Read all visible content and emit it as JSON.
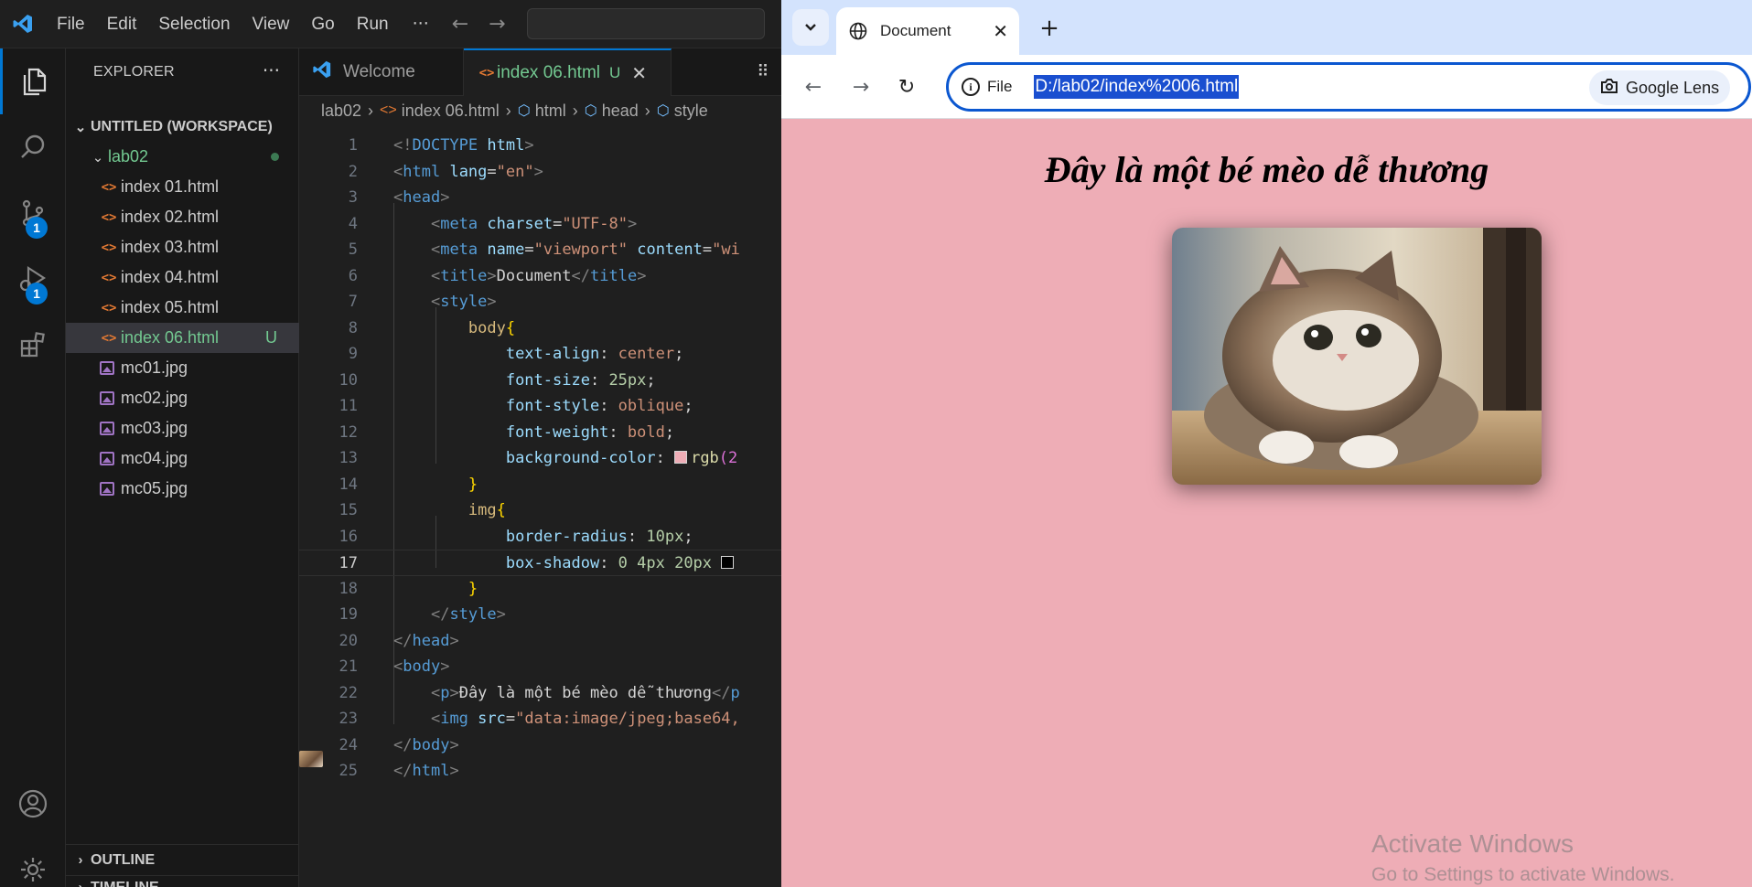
{
  "vscode": {
    "menu": [
      "File",
      "Edit",
      "Selection",
      "View",
      "Go",
      "Run"
    ],
    "menu_more": "···",
    "sidebar": {
      "title": "EXPLORER",
      "workspace": "UNTITLED (WORKSPACE)",
      "folder": "lab02",
      "files": [
        {
          "name": "index 01.html",
          "kind": "html"
        },
        {
          "name": "index 02.html",
          "kind": "html"
        },
        {
          "name": "index 03.html",
          "kind": "html"
        },
        {
          "name": "index 04.html",
          "kind": "html"
        },
        {
          "name": "index 05.html",
          "kind": "html"
        },
        {
          "name": "index 06.html",
          "kind": "html",
          "status": "U",
          "selected": true
        },
        {
          "name": "mc01.jpg",
          "kind": "image"
        },
        {
          "name": "mc02.jpg",
          "kind": "image"
        },
        {
          "name": "mc03.jpg",
          "kind": "image"
        },
        {
          "name": "mc04.jpg",
          "kind": "image"
        },
        {
          "name": "mc05.jpg",
          "kind": "image"
        }
      ],
      "outline": "OUTLINE",
      "timeline": "TIMELINE"
    },
    "badges": {
      "source_control": "1",
      "run_debug": "1"
    },
    "tabs": [
      {
        "label": "Welcome"
      },
      {
        "label": "index 06.html",
        "status": "U",
        "active": true
      }
    ],
    "breadcrumb": [
      "lab02",
      "index 06.html",
      "html",
      "head",
      "style"
    ],
    "current_line": 17,
    "lines": [
      {
        "n": "1",
        "html": "<span class='t-br'>&lt;!</span><span class='t-tag'>DOCTYPE</span> <span class='t-attr'>html</span><span class='t-br'>&gt;</span>"
      },
      {
        "n": "2",
        "html": "<span class='t-br'>&lt;</span><span class='t-tag'>html</span> <span class='t-attr'>lang</span><span class='t-txt'>=</span><span class='t-str'>\"en\"</span><span class='t-br'>&gt;</span>"
      },
      {
        "n": "3",
        "html": "<span class='t-br'>&lt;</span><span class='t-tag'>head</span><span class='t-br'>&gt;</span>"
      },
      {
        "n": "4",
        "html": "    <span class='t-br'>&lt;</span><span class='t-tag'>meta</span> <span class='t-attr'>charset</span><span class='t-txt'>=</span><span class='t-str'>\"UTF-8\"</span><span class='t-br'>&gt;</span>"
      },
      {
        "n": "5",
        "html": "    <span class='t-br'>&lt;</span><span class='t-tag'>meta</span> <span class='t-attr'>name</span><span class='t-txt'>=</span><span class='t-str'>\"viewport\"</span> <span class='t-attr'>content</span><span class='t-txt'>=</span><span class='t-str'>\"wi</span>"
      },
      {
        "n": "6",
        "html": "    <span class='t-br'>&lt;</span><span class='t-tag'>title</span><span class='t-br'>&gt;</span><span class='t-txt'>Document</span><span class='t-br'>&lt;/</span><span class='t-tag'>title</span><span class='t-br'>&gt;</span>"
      },
      {
        "n": "7",
        "html": "    <span class='t-br'>&lt;</span><span class='t-tag'>style</span><span class='t-br'>&gt;</span>"
      },
      {
        "n": "8",
        "html": "        <span class='t-sel'>body</span><span class='t-brace'>{</span>"
      },
      {
        "n": "9",
        "html": "            <span class='t-prop'>text-align</span><span class='t-txt'>: </span><span class='t-val'>center</span><span class='t-txt'>;</span>"
      },
      {
        "n": "10",
        "html": "            <span class='t-prop'>font-size</span><span class='t-txt'>: </span><span class='t-num'>25px</span><span class='t-txt'>;</span>"
      },
      {
        "n": "11",
        "html": "            <span class='t-prop'>font-style</span><span class='t-txt'>: </span><span class='t-val'>oblique</span><span class='t-txt'>;</span>"
      },
      {
        "n": "12",
        "html": "            <span class='t-prop'>font-weight</span><span class='t-txt'>: </span><span class='t-val'>bold</span><span class='t-txt'>;</span>"
      },
      {
        "n": "13",
        "html": "            <span class='t-prop'>background-color</span><span class='t-txt'>: </span><span class='swatch' style='background:#eeadb6'></span><span class='t-fn'>rgb</span><span class='t-purple'>(2</span>"
      },
      {
        "n": "14",
        "html": "        <span class='t-brace'>}</span>"
      },
      {
        "n": "15",
        "html": "        <span class='t-sel'>img</span><span class='t-brace'>{</span>"
      },
      {
        "n": "16",
        "html": "            <span class='t-prop'>border-radius</span><span class='t-txt'>: </span><span class='t-num'>10px</span><span class='t-txt'>;</span>"
      },
      {
        "n": "17",
        "html": "            <span class='t-prop'>box-shadow</span><span class='t-txt'>: </span><span class='t-num'>0 4px 20px</span> <span class='swatch' style='background:#000'></span>"
      },
      {
        "n": "18",
        "html": "        <span class='t-brace'>}</span>"
      },
      {
        "n": "19",
        "html": "    <span class='t-br'>&lt;/</span><span class='t-tag'>style</span><span class='t-br'>&gt;</span>"
      },
      {
        "n": "20",
        "html": "<span class='t-br'>&lt;/</span><span class='t-tag'>head</span><span class='t-br'>&gt;</span>"
      },
      {
        "n": "21",
        "html": "<span class='t-br'>&lt;</span><span class='t-tag'>body</span><span class='t-br'>&gt;</span>"
      },
      {
        "n": "22",
        "html": "    <span class='t-br'>&lt;</span><span class='t-tag'>p</span><span class='t-br'>&gt;</span><span class='t-txt'>Đây là một bé mèo dễ thương</span><span class='t-br'>&lt;/</span><span class='t-tag'>p</span>"
      },
      {
        "n": "23",
        "html": "    <span class='t-br'>&lt;</span><span class='t-tag'>img</span> <span class='t-attr'>src</span><span class='t-txt'>=</span><span class='t-str'>\"data:image/jpeg;base64,</span>"
      },
      {
        "n": "24",
        "html": "<span class='t-br'>&lt;/</span><span class='t-tag'>body</span><span class='t-br'>&gt;</span>"
      },
      {
        "n": "25",
        "html": "<span class='t-br'>&lt;/</span><span class='t-tag'>html</span><span class='t-br'>&gt;</span>"
      }
    ]
  },
  "browser": {
    "tab_title": "Document",
    "new_tab": "+",
    "omnibox": {
      "scheme_label": "File",
      "url": "D:/lab02/index%2006.html"
    },
    "lens_label": "Google Lens",
    "page": {
      "heading": "Đây là một bé mèo dễ thương",
      "background": "#eeadb6"
    },
    "watermark": {
      "line1": "Activate Windows",
      "line2": "Go to Settings to activate Windows."
    }
  },
  "colors": {
    "accent": "#0078d4",
    "untracked": "#73c991",
    "browser_accent": "#0b57d0"
  }
}
